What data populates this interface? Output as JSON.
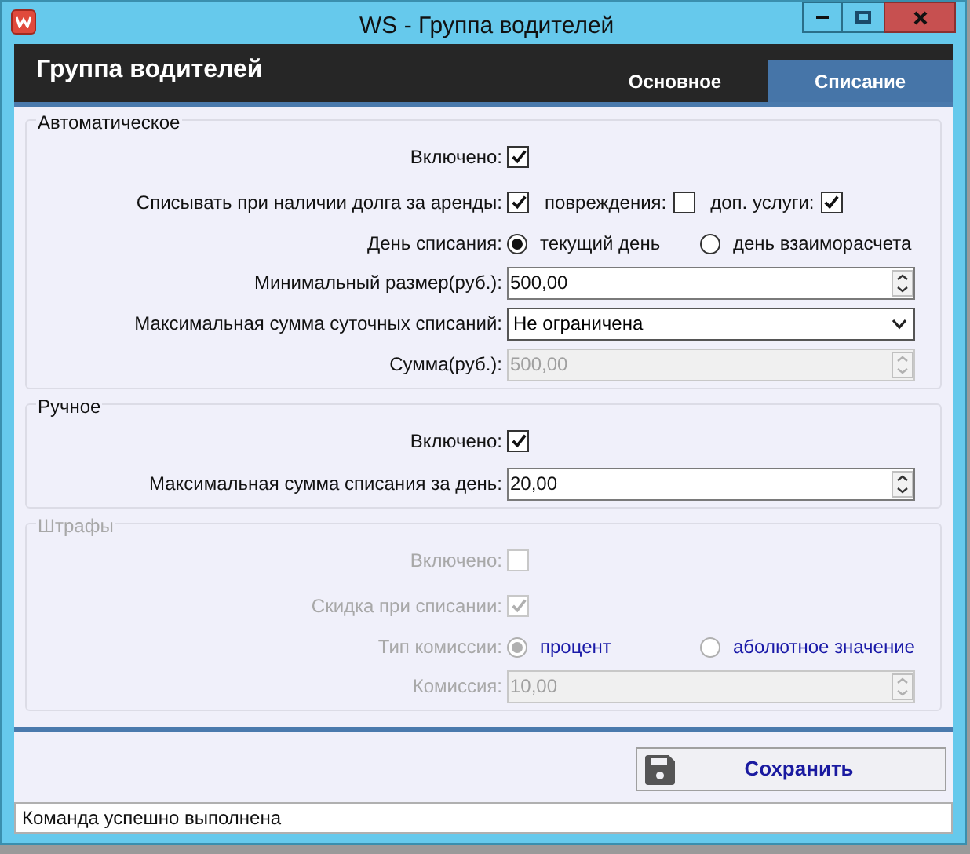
{
  "window": {
    "title": "WS - Группа водителей"
  },
  "header": {
    "title": "Группа водителей",
    "tabs": [
      {
        "label": "Основное",
        "selected": false
      },
      {
        "label": "Списание",
        "selected": true
      }
    ]
  },
  "groups": [
    {
      "title": "Автоматическое",
      "disabled": false,
      "rows": [
        {
          "kind": "checkbox",
          "label": "Включено:",
          "checked": true
        },
        {
          "kind": "checkbox_set",
          "label": "Списывать при наличии долга за аренды:",
          "checked": true,
          "items": [
            {
              "label": "повреждения:",
              "checked": false
            },
            {
              "label": "доп. услуги:",
              "checked": true
            }
          ]
        },
        {
          "kind": "radio",
          "label": "День списания:",
          "options": [
            {
              "label": "текущий день",
              "selected": true
            },
            {
              "label": "день взаиморасчета",
              "selected": false
            }
          ]
        },
        {
          "kind": "spin",
          "label": "Минимальный размер(руб.):",
          "value": "500,00",
          "disabled": false
        },
        {
          "kind": "dropdown",
          "label": "Максимальная сумма суточных списаний:",
          "value": "Не ограничена"
        },
        {
          "kind": "spin",
          "label": "Сумма(руб.):",
          "value": "500,00",
          "disabled": true
        }
      ]
    },
    {
      "title": "Ручное",
      "disabled": false,
      "rows": [
        {
          "kind": "checkbox",
          "label": "Включено:",
          "checked": true
        },
        {
          "kind": "spin",
          "label": "Максимальная сумма списания за день:",
          "value": "20,00",
          "disabled": false
        }
      ]
    },
    {
      "title": "Штрафы",
      "disabled": true,
      "rows": [
        {
          "kind": "checkbox",
          "label": "Включено:",
          "checked": false
        },
        {
          "kind": "checkbox",
          "label": "Скидка при списании:",
          "checked": true
        },
        {
          "kind": "radio",
          "label": "Тип комиссии:",
          "options": [
            {
              "label": "процент",
              "selected": true
            },
            {
              "label": "аболютное значение",
              "selected": false
            }
          ]
        },
        {
          "kind": "spin",
          "label": "Комиссия:",
          "value": "10,00"
        }
      ]
    }
  ],
  "save_button": {
    "label": "Сохранить"
  },
  "status_bar": "Команда успешно выполнена"
}
